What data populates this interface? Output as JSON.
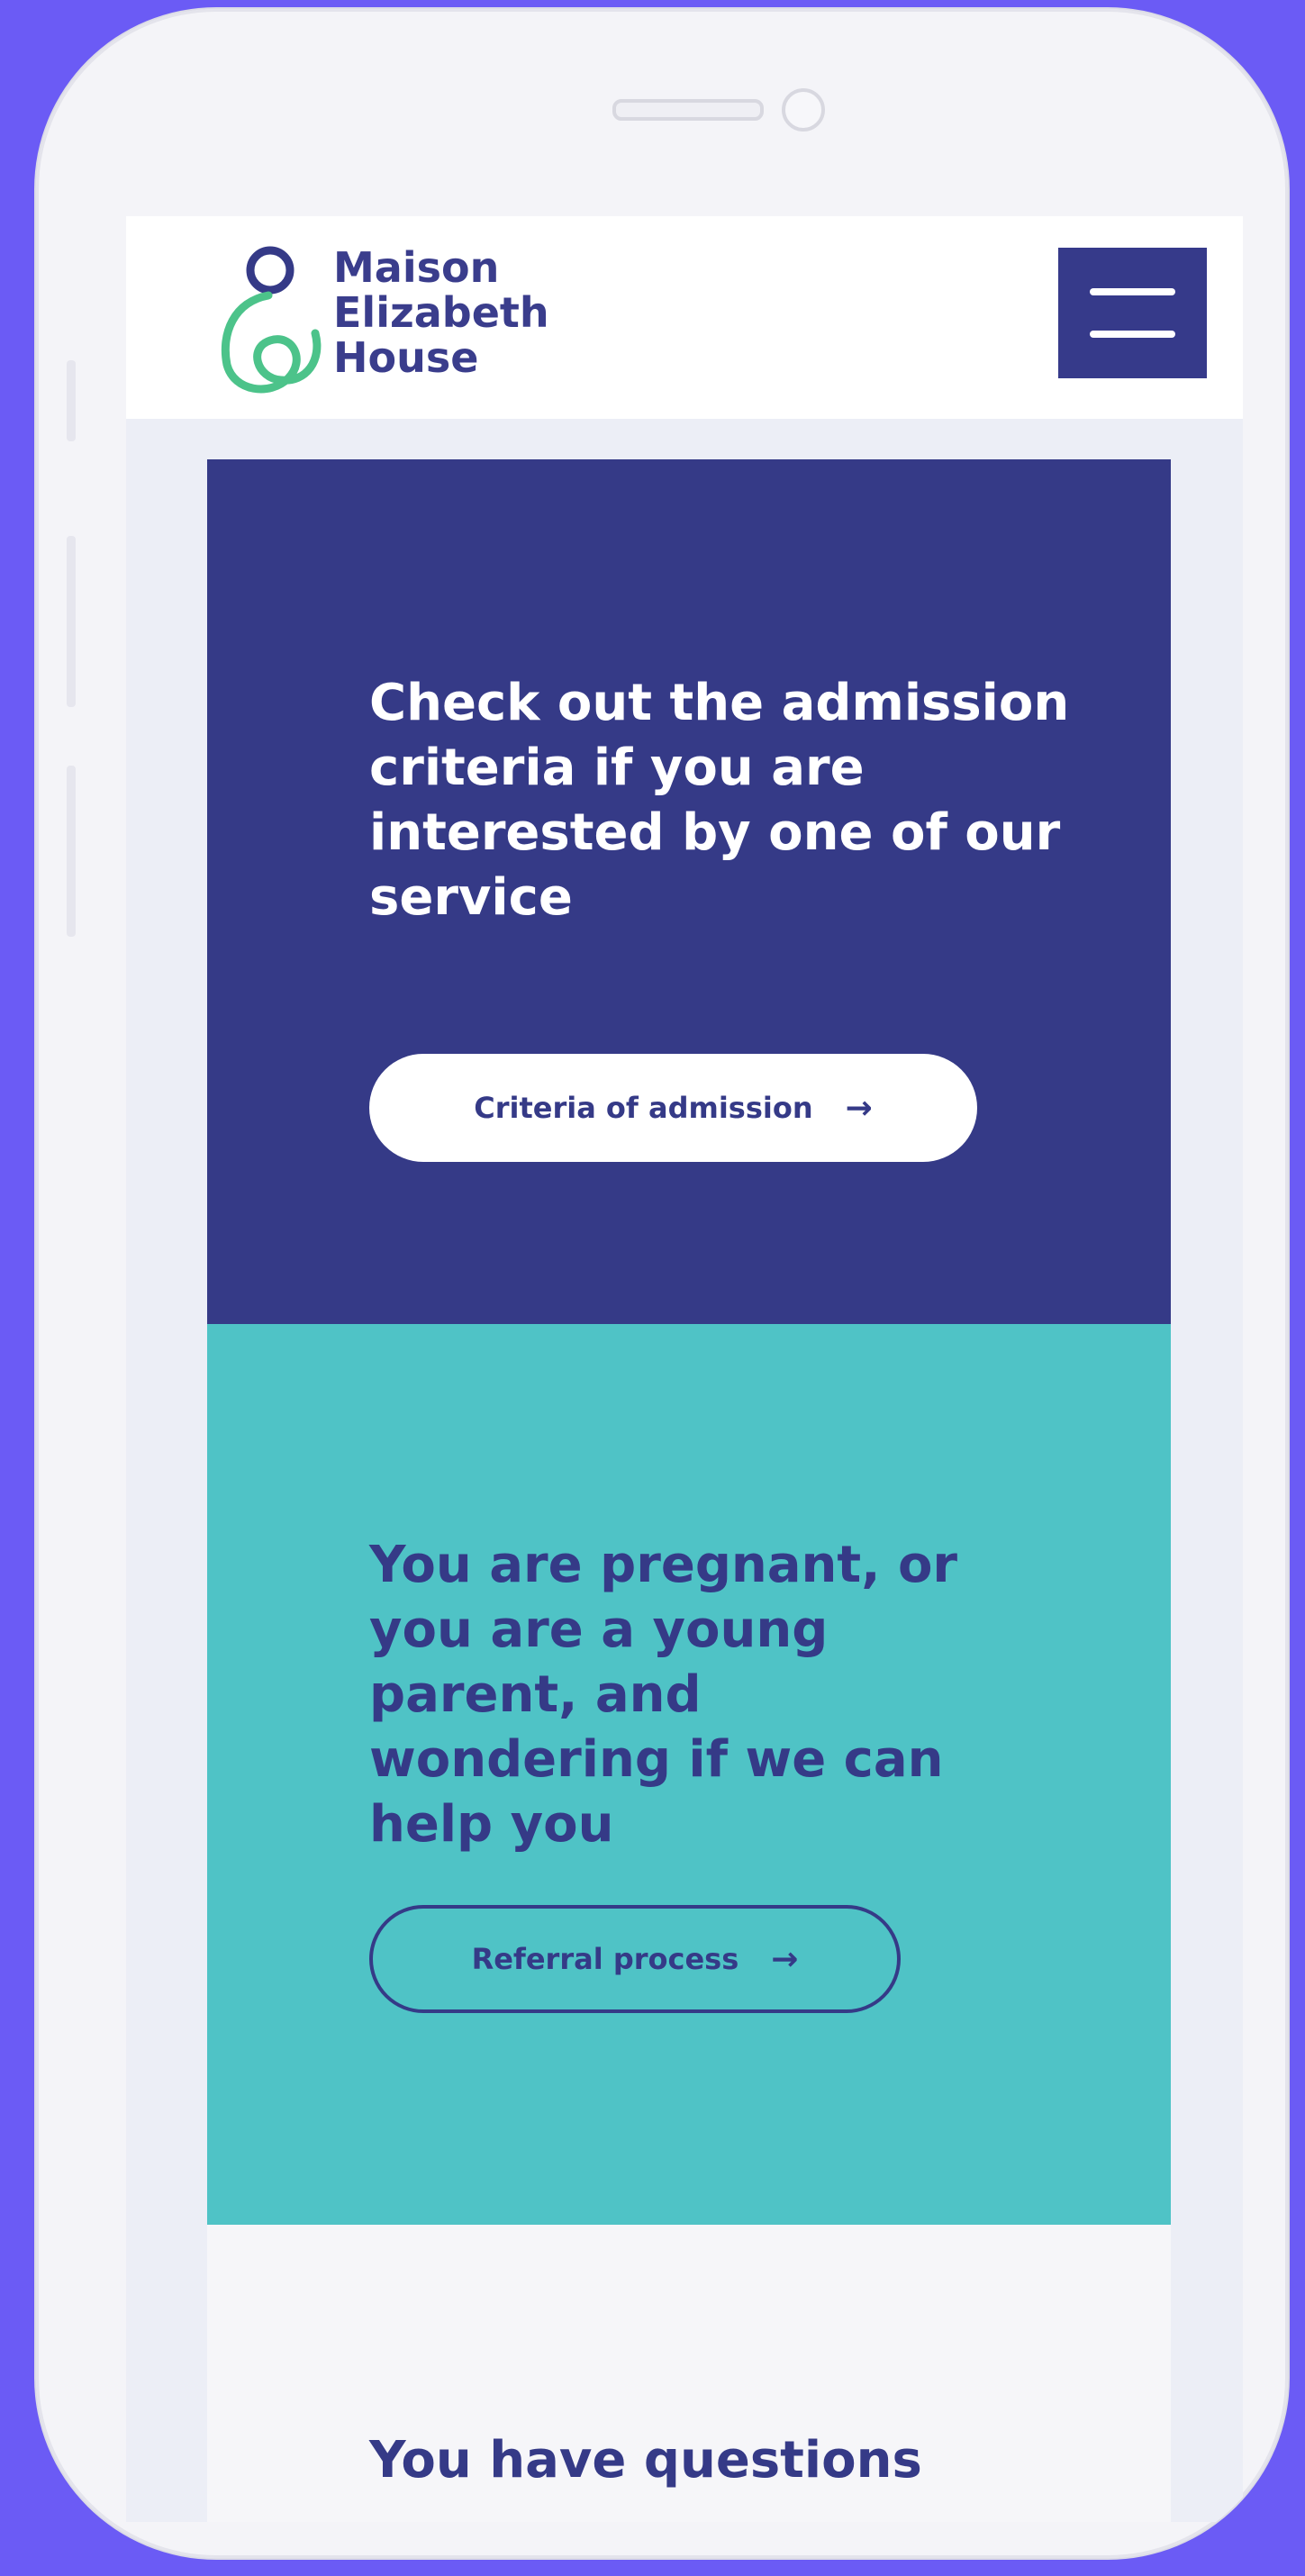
{
  "colors": {
    "background": "#6b5bf5",
    "navy": "#353a87",
    "teal": "#4fc3c6",
    "logo_green": "#4cc38a",
    "white": "#ffffff"
  },
  "header": {
    "brand_line1": "Maison",
    "brand_line2": "Elizabeth",
    "brand_line3": "House",
    "menu_icon": "hamburger-icon"
  },
  "admission": {
    "heading": "Check out the admission criteria if you are interested by one of our service",
    "button_label": "Criteria of admission",
    "button_icon": "arrow-right-icon"
  },
  "referral": {
    "heading": "You are pregnant, or you are a young parent, and wondering if we can help you",
    "button_label": "Referral process",
    "button_icon": "arrow-right-icon"
  },
  "questions": {
    "heading": "You have questions"
  }
}
